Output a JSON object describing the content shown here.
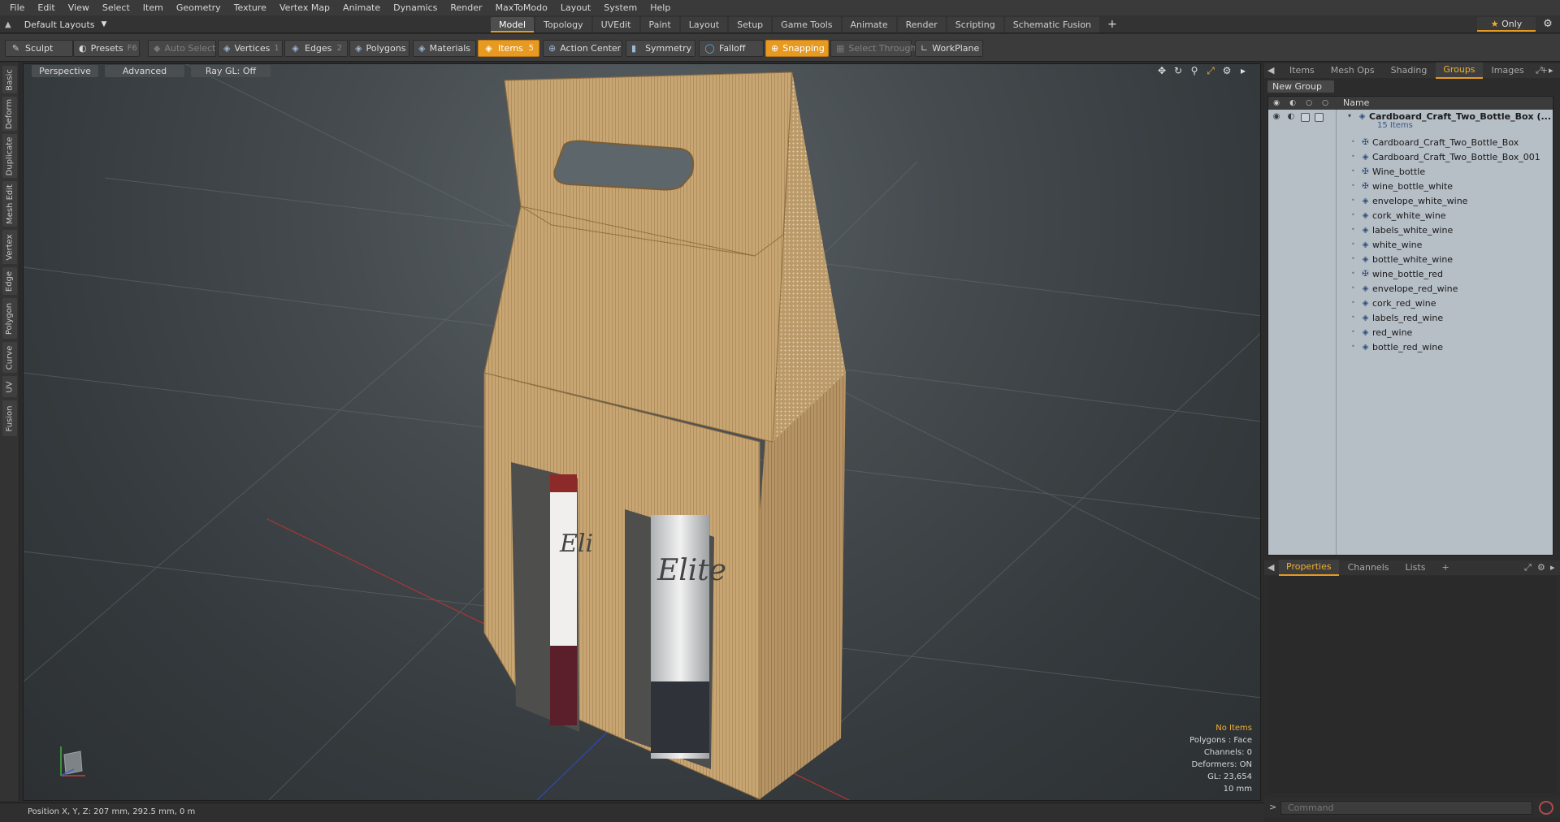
{
  "menu": [
    "File",
    "Edit",
    "View",
    "Select",
    "Item",
    "Geometry",
    "Texture",
    "Vertex Map",
    "Animate",
    "Dynamics",
    "Render",
    "MaxToModo",
    "Layout",
    "System",
    "Help"
  ],
  "layout_select": "Default Layouts",
  "layout_tabs": [
    "Model",
    "Topology",
    "UVEdit",
    "Paint",
    "Layout",
    "Setup",
    "Game Tools",
    "Animate",
    "Render",
    "Scripting",
    "Schematic Fusion"
  ],
  "active_layout_tab": "Model",
  "only_label": "Only",
  "toolbar": {
    "sculpt": "Sculpt",
    "presets": "Presets",
    "presets_key": "F6",
    "auto_select": "Auto Select",
    "vertices": "Vertices",
    "vertices_key": "1",
    "edges": "Edges",
    "edges_key": "2",
    "polygons": "Polygons",
    "materials": "Materials",
    "items": "Items",
    "items_key": "5",
    "action_center": "Action Center",
    "symmetry": "Symmetry",
    "falloff": "Falloff",
    "snapping": "Snapping",
    "select_through": "Select Through",
    "workplane": "WorkPlane"
  },
  "left_tabs": [
    "Basic",
    "Deform",
    "Duplicate",
    "Mesh Edit",
    "Vertex",
    "Edge",
    "Polygon",
    "Curve",
    "UV",
    "Fusion"
  ],
  "viewport": {
    "view": "Perspective",
    "shading": "Advanced",
    "raygl": "Ray GL: Off",
    "info": {
      "selection": "No Items",
      "polygons": "Polygons : Face",
      "channels": "Channels: 0",
      "deformers": "Deformers: ON",
      "gl": "GL: 23,654",
      "scale": "10 mm"
    }
  },
  "status": "Position X, Y, Z:  207 mm, 292.5 mm, 0 m",
  "right_panel": {
    "tabs": [
      "Items",
      "Mesh Ops",
      "Shading",
      "Groups",
      "Images"
    ],
    "active_tab": "Groups",
    "new_group": "New Group",
    "name_header": "Name",
    "root": {
      "label": "Cardboard_Craft_Two_Bottle_Box (...",
      "count": "15 Items"
    },
    "items": [
      {
        "label": "Cardboard_Craft_Two_Bottle_Box",
        "icon": "locator-icon"
      },
      {
        "label": "Cardboard_Craft_Two_Bottle_Box_001",
        "icon": "mesh-icon"
      },
      {
        "label": "Wine_bottle",
        "icon": "locator-icon"
      },
      {
        "label": "wine_bottle_white",
        "icon": "locator-icon"
      },
      {
        "label": "envelope_white_wine",
        "icon": "mesh-icon"
      },
      {
        "label": "cork_white_wine",
        "icon": "mesh-icon"
      },
      {
        "label": "labels_white_wine",
        "icon": "mesh-icon"
      },
      {
        "label": "white_wine",
        "icon": "mesh-icon"
      },
      {
        "label": "bottle_white_wine",
        "icon": "mesh-icon"
      },
      {
        "label": "wine_bottle_red",
        "icon": "locator-icon"
      },
      {
        "label": "envelope_red_wine",
        "icon": "mesh-icon"
      },
      {
        "label": "cork_red_wine",
        "icon": "mesh-icon"
      },
      {
        "label": "labels_red_wine",
        "icon": "mesh-icon"
      },
      {
        "label": "red_wine",
        "icon": "mesh-icon"
      },
      {
        "label": "bottle_red_wine",
        "icon": "mesh-icon"
      }
    ],
    "bottom_tabs": [
      "Properties",
      "Channels",
      "Lists"
    ],
    "active_bottom_tab": "Properties",
    "command_placeholder": "Command"
  },
  "colors": {
    "accent": "#e69a22",
    "tree_bg": "#b6bec6",
    "cardboard": "#c9a874"
  }
}
